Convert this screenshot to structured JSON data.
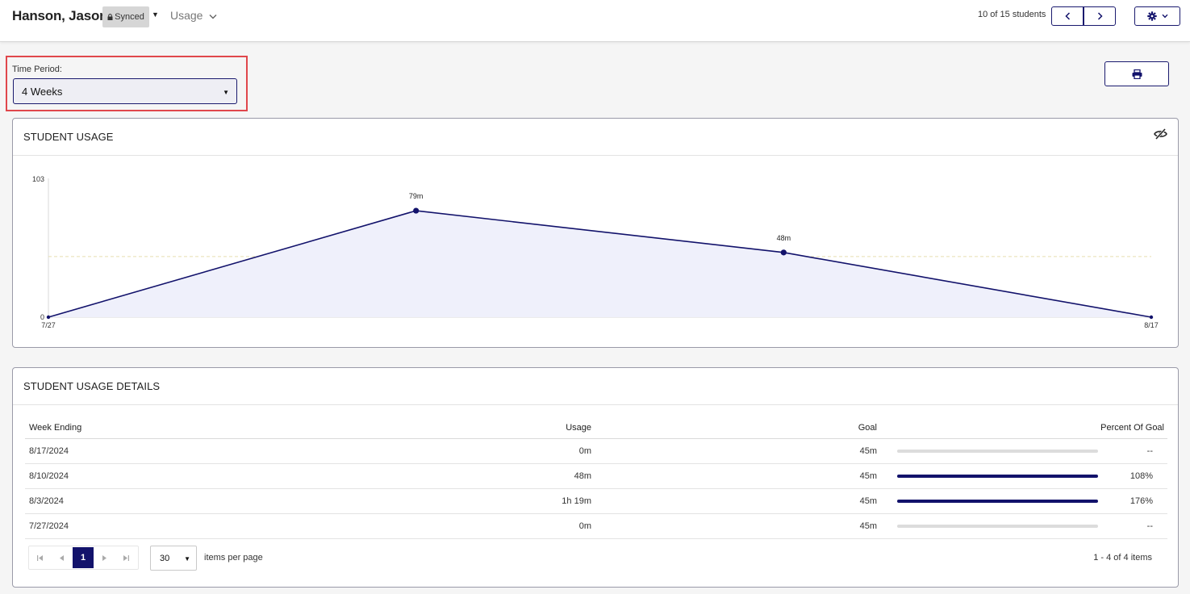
{
  "header": {
    "student_name": "Hanson, Jason",
    "synced_label": "Synced",
    "section_label": "Usage",
    "student_count": "10 of 15 students"
  },
  "time_period": {
    "label": "Time Period:",
    "value": "4 Weeks"
  },
  "usage_card": {
    "title": "STUDENT USAGE",
    "chart_data": {
      "type": "area",
      "x": [
        "7/27",
        "8/3",
        "8/10",
        "8/17"
      ],
      "x_tick_labels": [
        "7/27",
        "8/17"
      ],
      "values": [
        0,
        79,
        48,
        0
      ],
      "point_labels": [
        "",
        "79m",
        "48m",
        ""
      ],
      "y_tick_labels": [
        "0",
        "103"
      ],
      "ylim": [
        0,
        103
      ],
      "goal_line": 45,
      "colors": {
        "line": "#12126b",
        "fill": "#eff0fb",
        "goal": "#e8dfb0"
      }
    }
  },
  "details_card": {
    "title": "STUDENT USAGE DETAILS",
    "columns": [
      "Week Ending",
      "Usage",
      "Goal",
      "Percent Of Goal"
    ],
    "rows": [
      {
        "week": "8/17/2024",
        "usage": "0m",
        "goal": "45m",
        "progress": 0,
        "percent": "--"
      },
      {
        "week": "8/10/2024",
        "usage": "48m",
        "goal": "45m",
        "progress": 1.0,
        "percent": "108%"
      },
      {
        "week": "8/3/2024",
        "usage": "1h 19m",
        "goal": "45m",
        "progress": 1.0,
        "percent": "176%"
      },
      {
        "week": "7/27/2024",
        "usage": "0m",
        "goal": "45m",
        "progress": 0,
        "percent": "--"
      }
    ],
    "pager": {
      "current_page": "1",
      "page_size": "30",
      "per_page_label": "items per page",
      "range_label": "1 - 4 of 4 items"
    }
  },
  "colors": {
    "brand": "#12126b",
    "highlight_border": "#e0474c"
  }
}
